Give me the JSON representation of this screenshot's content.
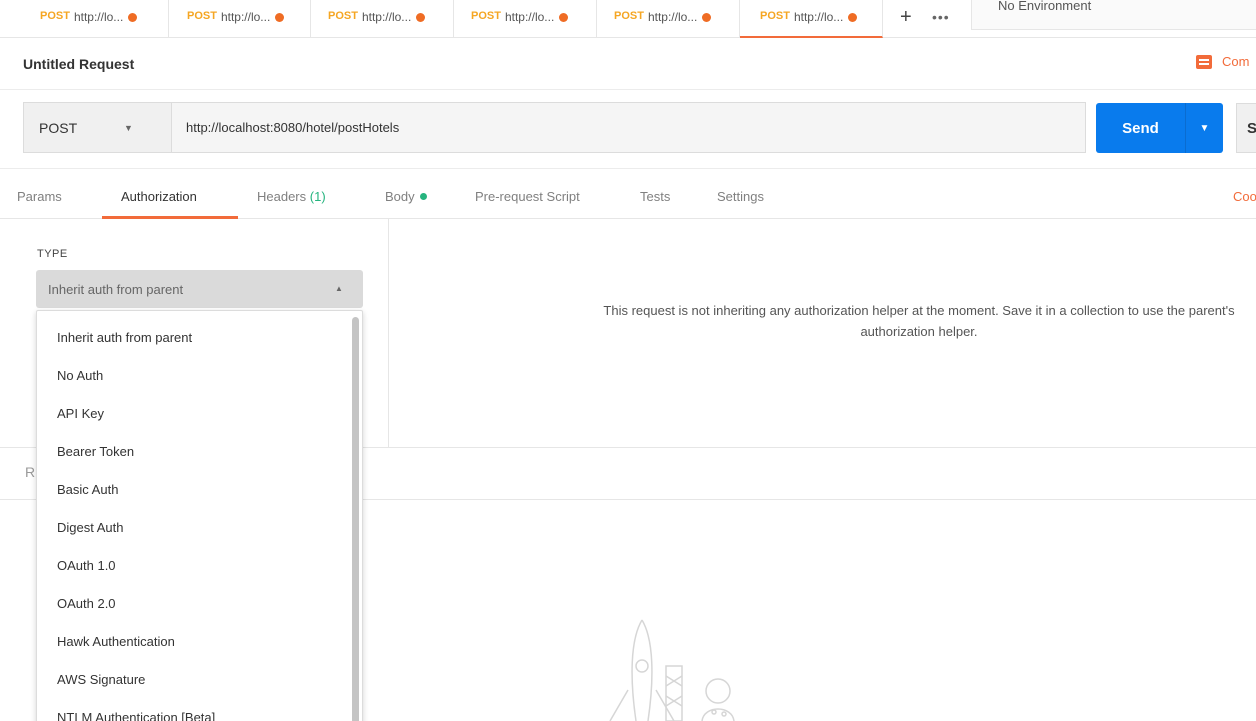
{
  "tabs": [
    {
      "method": "POST",
      "url": "http://lo..."
    },
    {
      "method": "POST",
      "url": "http://lo..."
    },
    {
      "method": "POST",
      "url": "http://lo..."
    },
    {
      "method": "POST",
      "url": "http://lo..."
    },
    {
      "method": "POST",
      "url": "http://lo..."
    },
    {
      "method": "POST",
      "url": "http://lo..."
    }
  ],
  "tab_add": "+",
  "tab_more": "•••",
  "environment": "No Environment",
  "request": {
    "title": "Untitled Request",
    "comments_label": "Com",
    "method": "POST",
    "url": "http://localhost:8080/hotel/postHotels",
    "send_label": "Send",
    "save_label": "S"
  },
  "subtabs": {
    "params": "Params",
    "authorization": "Authorization",
    "headers": "Headers",
    "headers_count": "(1)",
    "body": "Body",
    "prerequest": "Pre-request Script",
    "tests": "Tests",
    "settings": "Settings",
    "code": "Coo"
  },
  "auth": {
    "type_label": "TYPE",
    "selected": "Inherit auth from parent",
    "message_line1": "This request is not inheriting any authorization helper at the moment. Save it in a collection to use the parent's",
    "message_line2": "authorization helper.",
    "options": [
      "Inherit auth from parent",
      "No Auth",
      "API Key",
      "Bearer Token",
      "Basic Auth",
      "Digest Auth",
      "OAuth 1.0",
      "OAuth 2.0",
      "Hawk Authentication",
      "AWS Signature",
      "NTLM Authentication [Beta]"
    ]
  },
  "response": {
    "label": "R"
  },
  "colors": {
    "accent": "#f26b3a",
    "send": "#097bed",
    "method_post": "#f5a623",
    "unsaved_dot": "#ef6c24",
    "green": "#26b47f"
  }
}
